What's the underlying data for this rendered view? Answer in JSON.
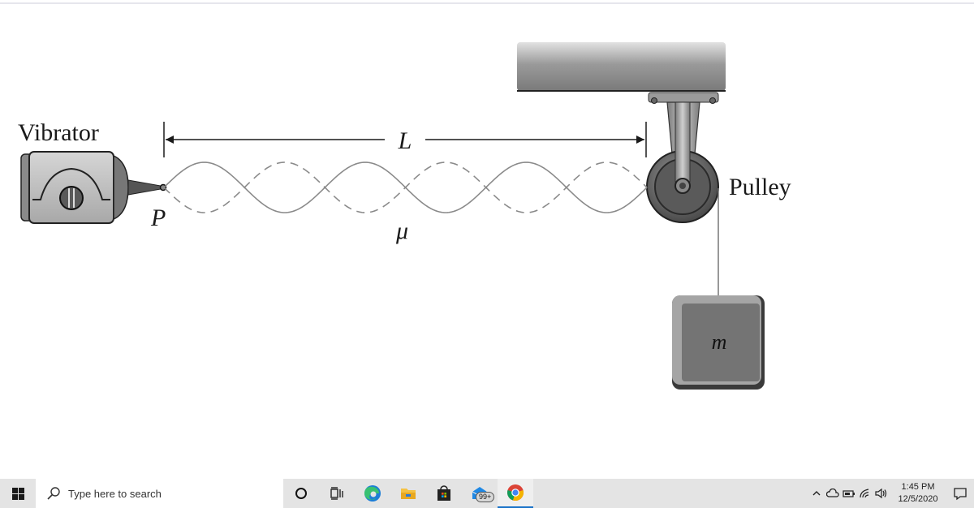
{
  "diagram": {
    "labels": {
      "vibrator": "Vibrator",
      "point": "P",
      "length": "L",
      "linear_density": "μ",
      "pulley": "Pulley",
      "mass": "m"
    },
    "standing_wave": {
      "loops": 6,
      "solid_line": "string displacement (one extreme)",
      "dashed_line": "string displacement (opposite extreme)"
    },
    "colors": {
      "string": "#8a8a8a",
      "dimension_line": "#1a1a1a",
      "ceiling_beam": "#8c8c8c",
      "mass_block": "#6e6e6e"
    }
  },
  "taskbar": {
    "start_icon": "windows-logo-icon",
    "search_placeholder": "Type here to search",
    "pinned": [
      {
        "name": "cortana",
        "icon": "cortana-circle-icon"
      },
      {
        "name": "task-view",
        "icon": "task-view-icon"
      },
      {
        "name": "edge",
        "icon": "edge-icon"
      },
      {
        "name": "file-explorer",
        "icon": "folder-icon"
      },
      {
        "name": "microsoft-store",
        "icon": "store-icon"
      },
      {
        "name": "mail",
        "icon": "mail-icon",
        "badge": "99+"
      },
      {
        "name": "chrome",
        "icon": "chrome-icon",
        "active": true
      }
    ],
    "tray": {
      "icons": [
        "chevron-up-icon",
        "onedrive-cloud-icon",
        "battery-icon",
        "wifi-icon",
        "volume-icon"
      ],
      "time": "1:45 PM",
      "date": "12/5/2020",
      "notification_icon": "action-center-icon"
    }
  }
}
